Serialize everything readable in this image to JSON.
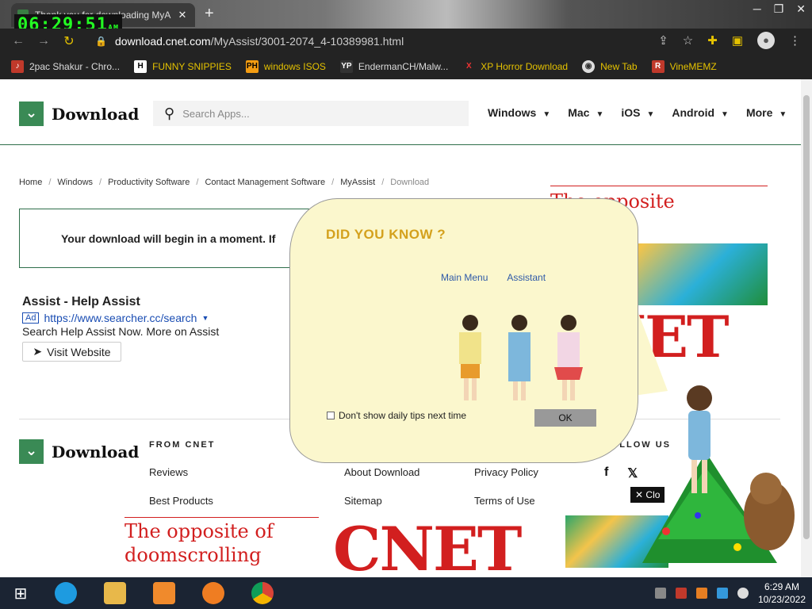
{
  "browser": {
    "tab_title": "Thank you for downloading MyA",
    "new_tab": "+",
    "url_host": "download.cnet.com",
    "url_path": "/MyAssist/3001-2074_4-10389981.html"
  },
  "clock_overlay": {
    "time": "06:29:51",
    "ampm": "AM"
  },
  "bookmarks": [
    {
      "label": "2pac Shakur - Chro..."
    },
    {
      "label": "FUNNY SNIPPIES"
    },
    {
      "label": "windows ISOS"
    },
    {
      "label": "EndermanCH/Malw..."
    },
    {
      "label": "XP Horror Download"
    },
    {
      "label": "New Tab"
    },
    {
      "label": "VineMEMZ"
    }
  ],
  "site": {
    "logo_text": "Download",
    "search_placeholder": "Search Apps...",
    "menu": [
      "Windows",
      "Mac",
      "iOS",
      "Android",
      "More"
    ]
  },
  "breadcrumb": [
    "Home",
    "Windows",
    "Productivity Software",
    "Contact Management Software",
    "MyAssist",
    "Download"
  ],
  "notice": "Your download will begin in a moment. If",
  "ad": {
    "title": "Assist - Help Assist",
    "tag": "Ad",
    "url": "https://www.searcher.cc/search",
    "desc": "Search Help Assist Now. More on Assist",
    "button": "Visit Website"
  },
  "footer": {
    "logo_text": "Download",
    "from_heading": "FROM CNET",
    "col1": [
      "Reviews",
      "Best Products"
    ],
    "col2": [
      "About Download",
      "Sitemap"
    ],
    "col3": [
      "Privacy Policy",
      "Terms of Use"
    ],
    "follow_heading": "FOLLOW US"
  },
  "ads_cnet": {
    "headline_side": "The opposite\nscrolling",
    "cnet": "CNET",
    "headline_bottom": "The opposite of doomscrolling",
    "close_label": "Clo"
  },
  "assistant": {
    "title": "DID YOU KNOW ?",
    "tab_main": "Main Menu",
    "tab_assistant": "Assistant",
    "checkbox_label": "Don't show daily tips next time",
    "ok": "OK"
  },
  "tray": {
    "time": "6:29 AM",
    "date": "10/23/2022"
  }
}
